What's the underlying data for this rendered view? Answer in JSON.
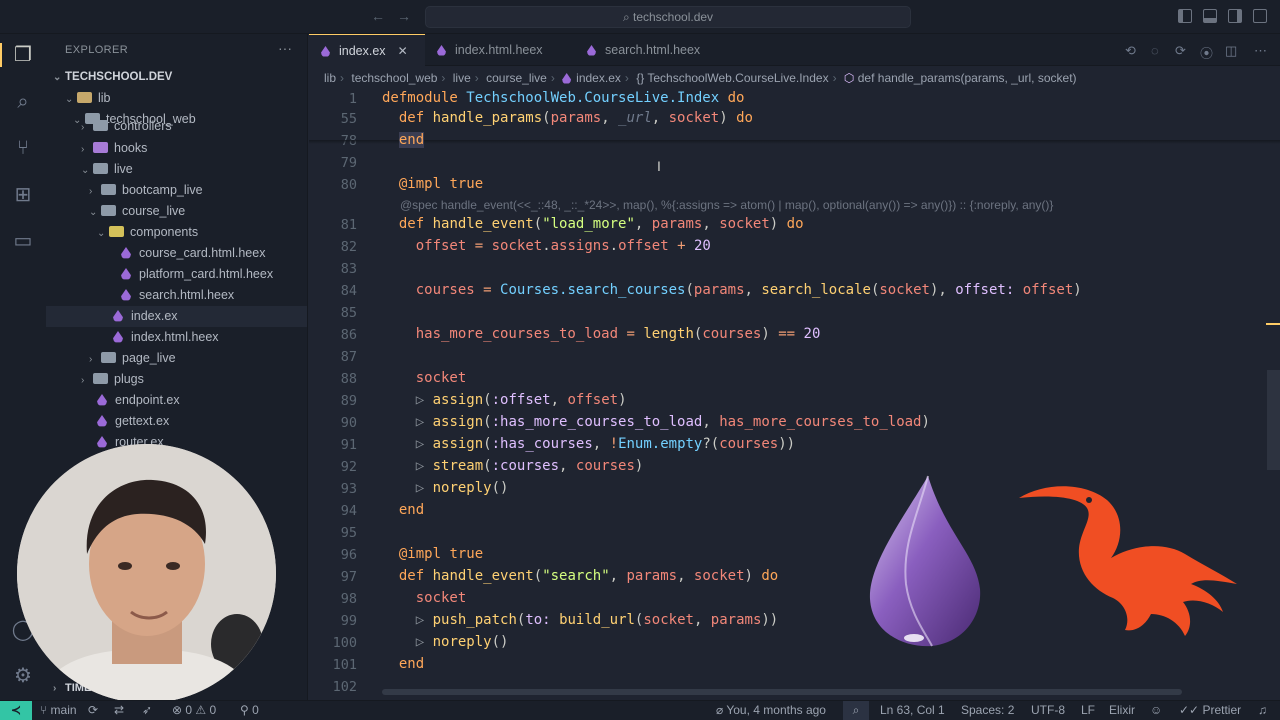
{
  "titlebar": {
    "search": "techschool.dev",
    "back_icon": "arrow-left-icon",
    "forward_icon": "arrow-right-icon"
  },
  "sidebar": {
    "title": "EXPLORER",
    "more": "···",
    "root": "TECHSCHOOL.DEV",
    "items": [
      {
        "label": "lib",
        "type": "folder-open"
      },
      {
        "label": "techschool_web",
        "type": "folder-open"
      },
      {
        "label": "controllers",
        "type": "folder"
      },
      {
        "label": "hooks",
        "type": "folder"
      },
      {
        "label": "live",
        "type": "folder-open"
      },
      {
        "label": "bootcamp_live",
        "type": "folder"
      },
      {
        "label": "course_live",
        "type": "folder-open"
      },
      {
        "label": "components",
        "type": "folder-open"
      },
      {
        "label": "course_card.html.heex",
        "type": "file"
      },
      {
        "label": "platform_card.html.heex",
        "type": "file"
      },
      {
        "label": "search.html.heex",
        "type": "file"
      },
      {
        "label": "index.ex",
        "type": "file",
        "active": true
      },
      {
        "label": "index.html.heex",
        "type": "file"
      },
      {
        "label": "page_live",
        "type": "folder"
      },
      {
        "label": "plugs",
        "type": "folder"
      },
      {
        "label": "endpoint.ex",
        "type": "file"
      },
      {
        "label": "gettext.ex",
        "type": "file"
      },
      {
        "label": "router.ex",
        "type": "file"
      }
    ],
    "timeline": "TIMELINE"
  },
  "tabs": [
    {
      "label": "index.ex",
      "active": true
    },
    {
      "label": "index.html.heex",
      "active": false
    },
    {
      "label": "search.html.heex",
      "active": false
    }
  ],
  "breadcrumb": [
    "lib",
    "techschool_web",
    "live",
    "course_live",
    "index.ex",
    "{} TechschoolWeb.CourseLive.Index",
    "def handle_params(params, _url, socket)"
  ],
  "editor": {
    "lines": [
      {
        "n": "1",
        "text": "defmodule TechschoolWeb.CourseLive.Index do"
      },
      {
        "n": "55",
        "text": "  def handle_params(params, _url, socket) do"
      },
      {
        "n": "78",
        "text": "  end"
      },
      {
        "n": "79",
        "text": ""
      },
      {
        "n": "80",
        "text": "  @impl true"
      },
      {
        "n": "81",
        "text": "  def handle_event(\"load_more\", params, socket) do"
      },
      {
        "n": "82",
        "text": "    offset = socket.assigns.offset + 20"
      },
      {
        "n": "83",
        "text": ""
      },
      {
        "n": "84",
        "text": "    courses = Courses.search_courses(params, search_locale(socket), offset: offset)"
      },
      {
        "n": "85",
        "text": ""
      },
      {
        "n": "86",
        "text": "    has_more_courses_to_load = length(courses) == 20"
      },
      {
        "n": "87",
        "text": ""
      },
      {
        "n": "88",
        "text": "    socket"
      },
      {
        "n": "89",
        "text": "    |> assign(:offset, offset)"
      },
      {
        "n": "90",
        "text": "    |> assign(:has_more_courses_to_load, has_more_courses_to_load)"
      },
      {
        "n": "91",
        "text": "    |> assign(:has_courses, !Enum.empty?(courses))"
      },
      {
        "n": "92",
        "text": "    |> stream(:courses, courses)"
      },
      {
        "n": "93",
        "text": "    |> noreply()"
      },
      {
        "n": "94",
        "text": "  end"
      },
      {
        "n": "95",
        "text": ""
      },
      {
        "n": "96",
        "text": "  @impl true"
      },
      {
        "n": "97",
        "text": "  def handle_event(\"search\", params, socket) do"
      },
      {
        "n": "98",
        "text": "    socket"
      },
      {
        "n": "99",
        "text": "    |> push_patch(to: build_url(socket, params))"
      },
      {
        "n": "100",
        "text": "    |> noreply()"
      },
      {
        "n": "101",
        "text": "  end"
      },
      {
        "n": "102",
        "text": ""
      }
    ],
    "spec_hint": "@spec handle_event(<<_::48, _::_*24>>, map(), %{:assigns => atom() | map(), optional(any()) => any()}) :: {:noreply, any()}"
  },
  "statusbar": {
    "branch": "main",
    "errors": "0",
    "warnings": "0",
    "ports": "0",
    "blame": "You, 4 months ago",
    "position": "Ln 63, Col 1",
    "spaces": "Spaces: 2",
    "encoding": "UTF-8",
    "eol": "LF",
    "language": "Elixir",
    "formatter": "Prettier"
  },
  "colors": {
    "accent": "#ffcc66",
    "remote": "#33c5a5",
    "elixir": "#9b6ad8",
    "phoenix": "#fd4f00"
  }
}
